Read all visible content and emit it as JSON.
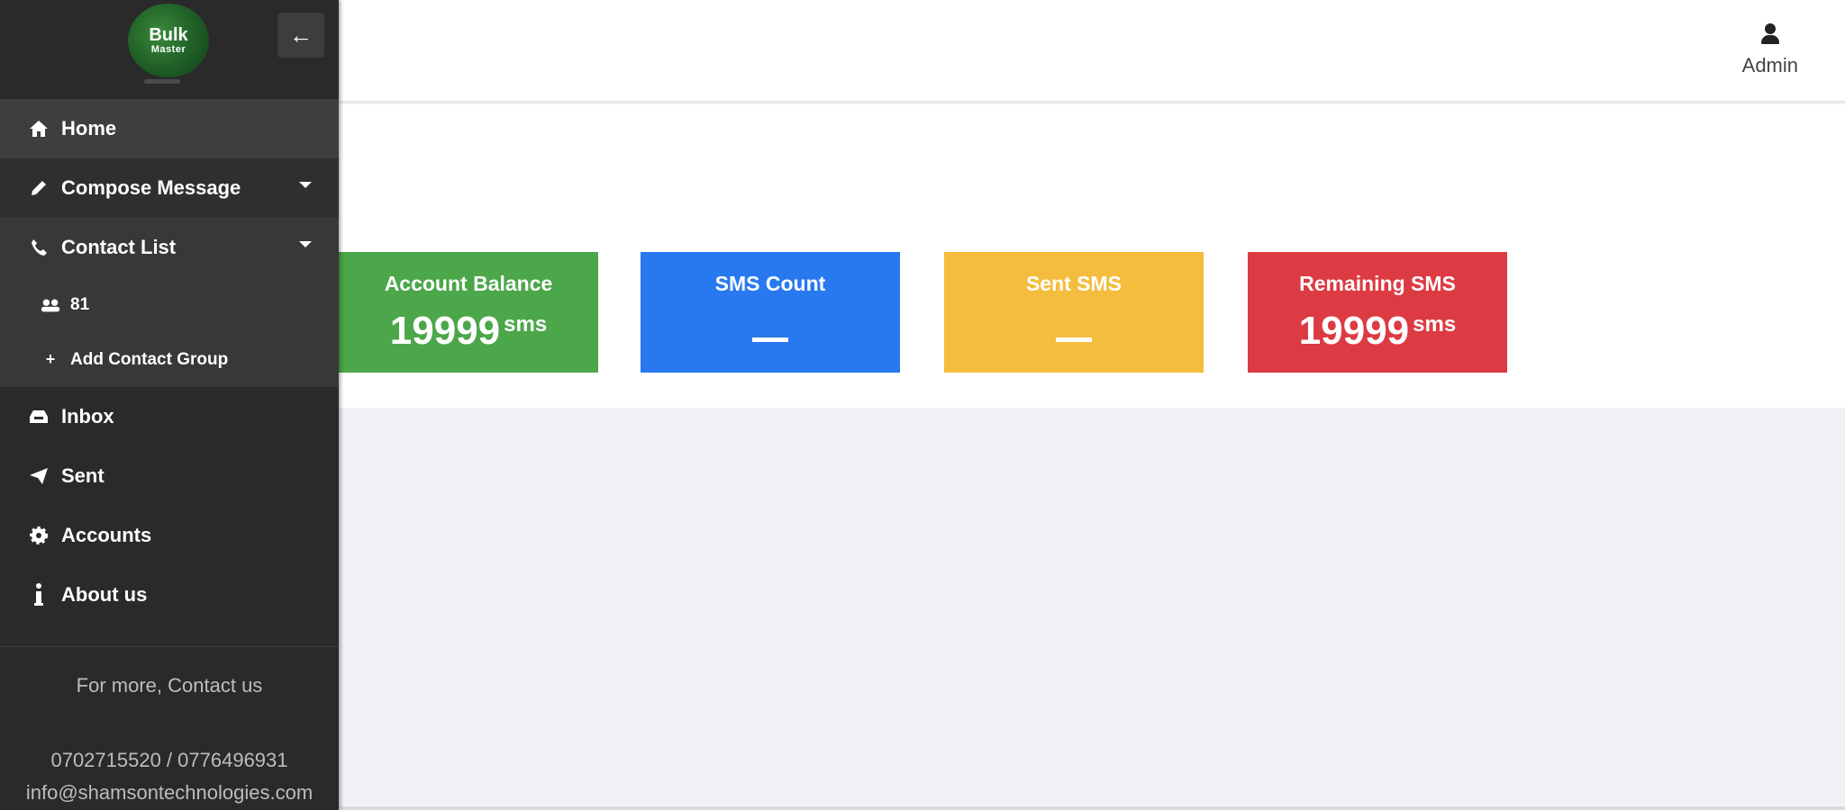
{
  "logo": {
    "line1": "Bulk",
    "line2": "Master"
  },
  "sidebar": {
    "items": [
      {
        "label": "Home",
        "icon": "home-icon"
      },
      {
        "label": "Compose Message",
        "icon": "pencil-icon"
      },
      {
        "label": "Contact List",
        "icon": "phone-icon"
      },
      {
        "label": "Inbox",
        "icon": "inbox-icon"
      },
      {
        "label": "Sent",
        "icon": "paper-plane-icon"
      },
      {
        "label": "Accounts",
        "icon": "gear-icon"
      },
      {
        "label": "About us",
        "icon": "info-icon"
      }
    ],
    "contact_sub": [
      {
        "label": "81",
        "icon": "users-icon"
      },
      {
        "label": "Add Contact Group",
        "icon": "plus-icon"
      }
    ],
    "footer": {
      "cta": "For more, Contact us",
      "phones": "0702715520 / 0776496931",
      "email": "info@shamsontechnologies.com"
    }
  },
  "topbar": {
    "user_label": "Admin",
    "user_icon": "user-icon"
  },
  "stats": [
    {
      "title": "Account Balance",
      "value": "19999",
      "unit": "sms",
      "color": "#4ca64a"
    },
    {
      "title": "SMS Count",
      "value": "",
      "unit": "",
      "color": "#2879f0"
    },
    {
      "title": "Sent SMS",
      "value": "",
      "unit": "",
      "color": "#f5bd3e"
    },
    {
      "title": "Remaining SMS",
      "value": "19999",
      "unit": "sms",
      "color": "#dc3b43"
    }
  ],
  "colors": {
    "sidebar_bg": "#2a2a2a",
    "page_bg": "#f0f1f5"
  }
}
